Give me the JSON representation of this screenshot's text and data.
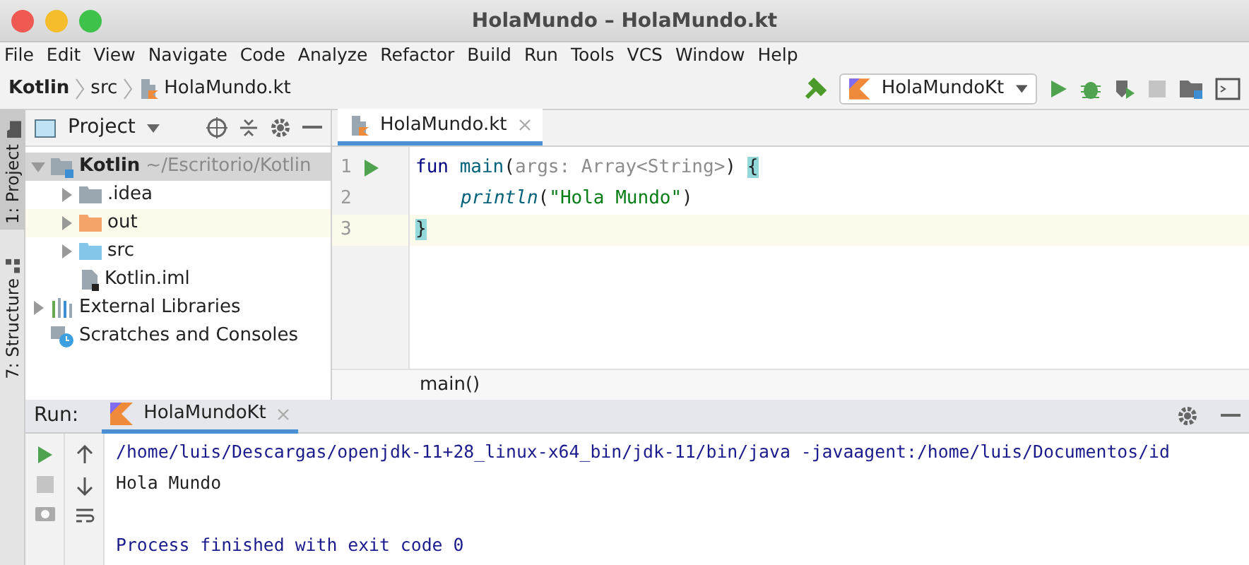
{
  "window": {
    "title": "HolaMundo – HolaMundo.kt"
  },
  "menu": [
    "File",
    "Edit",
    "View",
    "Navigate",
    "Code",
    "Analyze",
    "Refactor",
    "Build",
    "Run",
    "Tools",
    "VCS",
    "Window",
    "Help"
  ],
  "breadcrumbs": [
    "Kotlin",
    "src",
    "HolaMundo.kt"
  ],
  "run_config": {
    "label": "HolaMundoKt"
  },
  "side_tabs": [
    {
      "label": "1: Project",
      "selected": true
    },
    {
      "label": "7: Structure",
      "selected": false
    }
  ],
  "project_panel": {
    "title": "Project",
    "tree": [
      {
        "kind": "project",
        "label": "Kotlin",
        "path": "~/Escritorio/Kotlin",
        "expanded": true,
        "selected": true,
        "highlighted": false,
        "children": [
          {
            "kind": "folder",
            "label": ".idea",
            "color": "#9aa7b0",
            "expanded": false,
            "selected": false,
            "highlighted": false
          },
          {
            "kind": "folder",
            "label": "out",
            "color": "#f4a46b",
            "expanded": false,
            "selected": false,
            "highlighted": true
          },
          {
            "kind": "folder",
            "label": "src",
            "color": "#84c6ea",
            "expanded": false,
            "selected": false,
            "highlighted": false
          },
          {
            "kind": "file",
            "label": "Kotlin.iml",
            "selected": false,
            "highlighted": false
          }
        ]
      },
      {
        "kind": "libraries",
        "label": "External Libraries",
        "expanded": false,
        "selected": false,
        "highlighted": false
      },
      {
        "kind": "scratches",
        "label": "Scratches and Consoles",
        "selected": false,
        "highlighted": false
      }
    ]
  },
  "editor": {
    "tab": {
      "label": "HolaMundo.kt",
      "selected": true
    },
    "lines": [
      {
        "number": "1",
        "runnable": true,
        "current": false,
        "indented": false,
        "tokens": [
          {
            "kind": "keyword",
            "text": "fun "
          },
          {
            "kind": "function",
            "text": "main"
          },
          {
            "kind": "plain",
            "text": "("
          },
          {
            "kind": "hint",
            "text": "args: Array<String>"
          },
          {
            "kind": "plain",
            "text": ") "
          },
          {
            "kind": "brace",
            "text": "{"
          }
        ]
      },
      {
        "number": "2",
        "runnable": false,
        "current": false,
        "indented": true,
        "tokens": [
          {
            "kind": "call",
            "text": "println"
          },
          {
            "kind": "plain",
            "text": "("
          },
          {
            "kind": "string",
            "text": "\"Hola Mundo\""
          },
          {
            "kind": "plain",
            "text": ")"
          }
        ]
      },
      {
        "number": "3",
        "runnable": false,
        "current": true,
        "indented": false,
        "tokens": [
          {
            "kind": "brace",
            "text": "}"
          }
        ]
      }
    ],
    "breadcrumb": "main()"
  },
  "run_panel": {
    "label": "Run:",
    "tab": {
      "label": "HolaMundoKt",
      "selected": true
    },
    "console": [
      {
        "kind": "command",
        "text": "/home/luis/Descargas/openjdk-11+28_linux-x64_bin/jdk-11/bin/java -javaagent:/home/luis/Documentos/id"
      },
      {
        "kind": "output",
        "text": "Hola Mundo"
      },
      {
        "kind": "system",
        "text": "Process finished with exit code 0"
      }
    ]
  }
}
